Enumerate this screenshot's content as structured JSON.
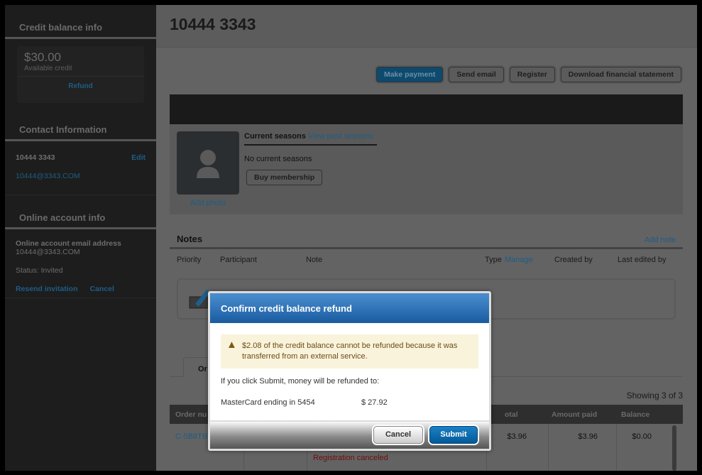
{
  "sidebar": {
    "credit_title": "Credit balance info",
    "credit_amount": "$30.00",
    "credit_label": "Available credit",
    "refund": "Refund",
    "contact_title": "Contact Information",
    "contact_name": "10444 3343",
    "edit": "Edit",
    "contact_email": "10444@3343.COM",
    "online_title": "Online account info",
    "online_email_label": "Online account email address",
    "online_email": "10444@3343.COM",
    "status": "Status: Invited",
    "resend": "Resend invitation",
    "cancel": "Cancel"
  },
  "header": {
    "title": "10444 3343"
  },
  "toolbar": {
    "make_payment": "Make payment",
    "send_email": "Send email",
    "register": "Register",
    "download": "Download financial statement"
  },
  "profile": {
    "current_seasons": "Current seasons",
    "view_past": "View past seasons",
    "no_seasons": "No current seasons",
    "buy": "Buy membership",
    "add_photo": "Add photo"
  },
  "notes": {
    "title": "Notes",
    "add_note": "Add note",
    "columns": [
      "Priority",
      "Participant",
      "Note",
      "Type",
      "Manage",
      "Created by",
      "Last edited by"
    ]
  },
  "orders": {
    "tab": "Or",
    "showing": "Showing 3 of 3",
    "columns": [
      "Order nu",
      "otal",
      "Amount paid",
      "Balance"
    ],
    "row": {
      "order": "C-5B8TB",
      "total": "$3.96",
      "paid": "$3.96",
      "balance": "$0.00",
      "status": "Registration canceled"
    }
  },
  "dialog": {
    "title": "Confirm credit balance refund",
    "warning": "$2.08 of the credit balance cannot be refunded because it was transferred from an external service.",
    "info": "If you click Submit, money will be refunded to:",
    "card": "MasterCard ending in 5454",
    "amount": "$ 27.92",
    "cancel": "Cancel",
    "submit": "Submit"
  }
}
